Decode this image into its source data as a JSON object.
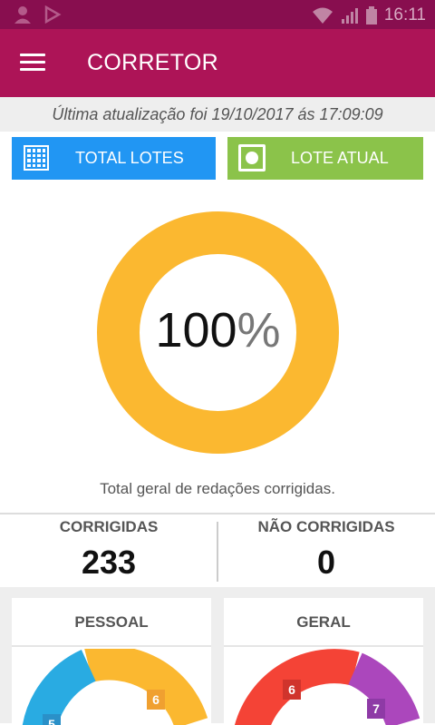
{
  "status_bar": {
    "time": "16:11"
  },
  "toolbar": {
    "title": "CORRETOR"
  },
  "last_update": "Última atualização foi 19/10/2017 ás 17:09:09",
  "buttons": {
    "total_lotes": "TOTAL LOTES",
    "lote_atual": "LOTE ATUAL"
  },
  "progress": {
    "value": "100",
    "unit": "%",
    "fraction": 1.0,
    "color": "#fbb830"
  },
  "caption": "Total geral de redações corrigidas.",
  "stats": {
    "corrigidas_label": "CORRIGIDAS",
    "corrigidas_value": "233",
    "nao_corrigidas_label": "NÃO CORRIGIDAS",
    "nao_corrigidas_value": "0"
  },
  "cards": {
    "pessoal": {
      "title": "PESSOAL",
      "badges": [
        "6",
        "5"
      ],
      "colors": [
        "#fbb830",
        "#29abe2"
      ]
    },
    "geral": {
      "title": "GERAL",
      "badges": [
        "6",
        "7"
      ],
      "colors": [
        "#f44336",
        "#ab47bc"
      ]
    }
  },
  "colors": {
    "toolbar": "#ad1457",
    "statusbar": "#880e4f",
    "blue_button": "#2196f3",
    "green_button": "#8bc34a"
  }
}
